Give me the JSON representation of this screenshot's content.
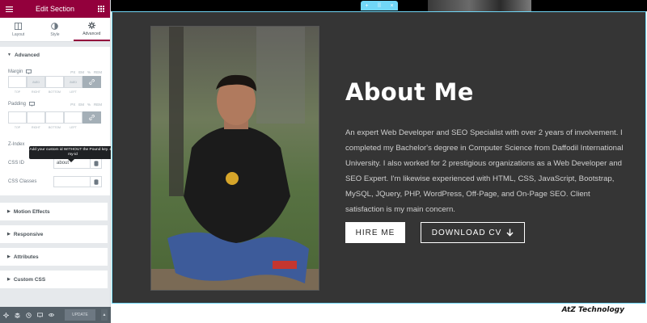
{
  "panel": {
    "header_title": "Edit Section",
    "tabs": [
      {
        "label": "Layout",
        "icon": "layout-icon"
      },
      {
        "label": "Style",
        "icon": "style-icon"
      },
      {
        "label": "Advanced",
        "icon": "gear-icon",
        "active": true
      }
    ],
    "advanced": {
      "title": "Advanced",
      "margin_label": "Margin",
      "padding_label": "Padding",
      "units": [
        "PX",
        "EM",
        "%",
        "REM"
      ],
      "margin_values": [
        "",
        "auto",
        "",
        "auto"
      ],
      "dim_labels": [
        "TOP",
        "RIGHT",
        "BOTTOM",
        "LEFT"
      ],
      "zindex_label": "Z-Index",
      "cssid_label": "CSS ID",
      "cssid_value": "about",
      "cssclasses_label": "CSS Classes",
      "tooltip": "Add your custom id WITHOUT the Pound key. e.g: my-id"
    },
    "sections": [
      "Motion Effects",
      "Responsive",
      "Attributes",
      "Custom CSS"
    ],
    "update_label": "UPDATE"
  },
  "preview": {
    "about_title": "About Me",
    "about_text": "An expert Web Developer and SEO Specialist with over 2 years of involvement. I completed my Bachelor's degree in Computer Science from Daffodil International University. I also worked for 2 prestigious organizations as a Web Developer and SEO Expert. I'm likewise experienced with HTML, CSS, JavaScript, Bootstrap, MySQL, JQuery, PHP, WordPress, Off-Page, and On-Page SEO. Client satisfaction is my main concern.",
    "hire_label": "HIRE ME",
    "cv_label": "DOWNLOAD CV",
    "watermark": "AtZ Technology"
  },
  "colors": {
    "brand": "#93003c",
    "section_bg": "#353535",
    "editor_accent": "#71d7f7"
  }
}
